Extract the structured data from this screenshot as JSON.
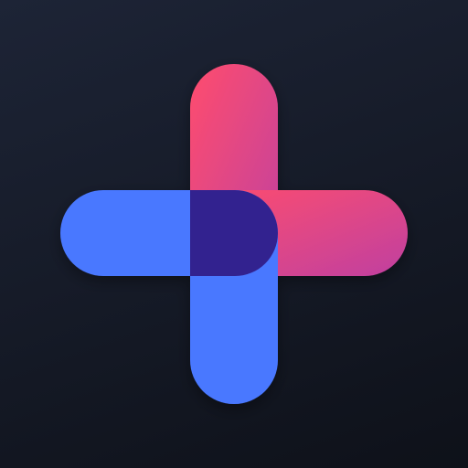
{
  "app_icon": {
    "icon": "plus-cross-logo-icon",
    "colors": {
      "background_top": "#1d2436",
      "background_bottom": "#0e1119",
      "pink_start": "#ff4d6d",
      "pink_end": "#c040a0",
      "blue": "#4a78ff",
      "overlap": "#33208f"
    }
  }
}
